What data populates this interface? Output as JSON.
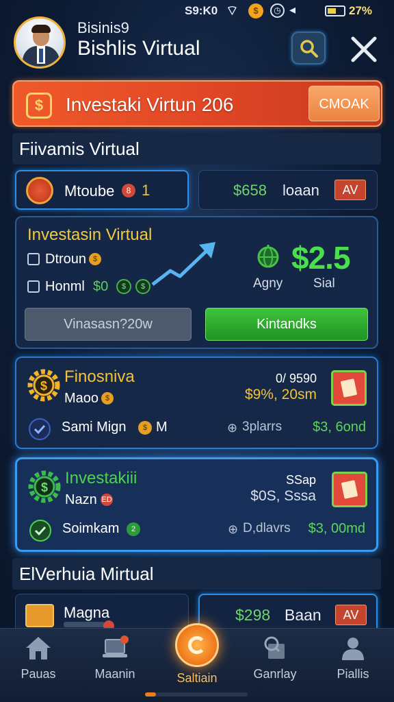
{
  "status_bar": {
    "time": "S9:K0",
    "battery_text": "27%"
  },
  "header": {
    "subtitle": "Bisinis9",
    "title": "Bishlis Virtual"
  },
  "promo": {
    "icon_text": "$",
    "text": "Investaki Virtun 206",
    "button": "CMOAK"
  },
  "section1": {
    "title": "Fiivamis Virtual"
  },
  "tile_a": {
    "label": "Mtoube",
    "badge": "8",
    "count": "1"
  },
  "tile_b": {
    "amount": "$658",
    "label": "loaan",
    "button": "AV"
  },
  "invest": {
    "title": "Investasin Virtual",
    "option1": "Dtroun",
    "option1_coin": "$",
    "option2": "Honml",
    "option2_value": "$0",
    "option2_coin_a": "$",
    "option2_coin_b": "$",
    "big_amount": "$2.5",
    "label_left": "Agny",
    "label_right": "Sial",
    "btn_left": "Vinasasn?20w",
    "btn_right": "Kintandks"
  },
  "card1": {
    "title": "Finosniva",
    "sub": "Maoo",
    "sub_badge": "$",
    "line1": "0/ 9590",
    "line2": "$9%, 20sm",
    "foot": "Sami Mign",
    "foot_icon": "$",
    "foot_m": "M",
    "dist": "3plarrs",
    "amount": "$3, 6ond"
  },
  "card2": {
    "title": "Investakiii",
    "sub": "Nazn",
    "sub_badge": "ED",
    "line1": "SSap",
    "line2": "$0S, Sssa",
    "foot": "Soimkam",
    "foot_icon": "2",
    "dist": "D,dlavrs",
    "amount": "$3, 00md"
  },
  "section2": {
    "title": "ElVerhuia Mirtual"
  },
  "tile_c": {
    "label": "Magna"
  },
  "tile_d": {
    "amount": "$298",
    "label": "Baan",
    "button": "AV"
  },
  "nav": [
    {
      "label": "Pauas",
      "icon": "home-icon"
    },
    {
      "label": "Maanin",
      "icon": "laptop-icon"
    },
    {
      "label": "Saltiain",
      "icon": "coin-icon"
    },
    {
      "label": "Ganrlay",
      "icon": "search-doc-icon"
    },
    {
      "label": "Piallis",
      "icon": "user-icon"
    }
  ],
  "colors": {
    "accent_orange": "#ef5a2a",
    "accent_green": "#49e04c",
    "gold": "#f2c93f",
    "glow_blue": "#2c8ee6",
    "bg": "#0d1c35"
  }
}
